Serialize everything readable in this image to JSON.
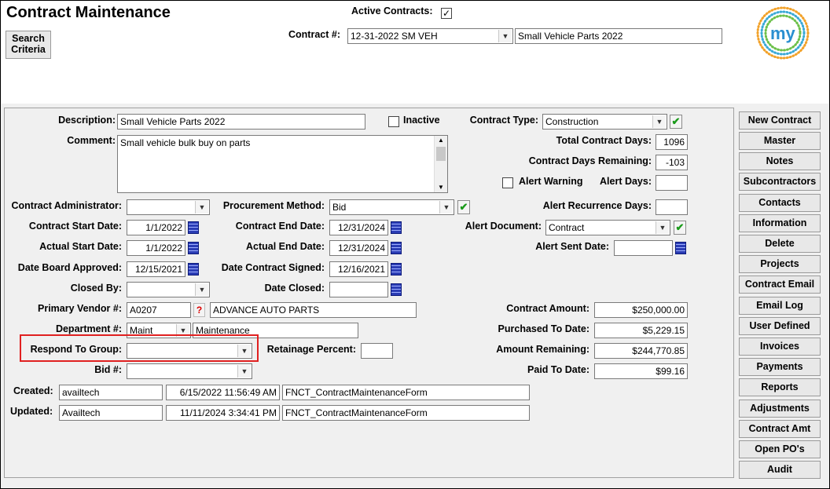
{
  "window": {
    "title": "Contract Maintenance"
  },
  "header": {
    "search_criteria": "Search\nCriteria",
    "active_contracts_label": "Active Contracts:",
    "active_contracts_checked": true,
    "contract_no_label": "Contract #:",
    "contract_no_value": "12-31-2022 SM VEH",
    "contract_name_value": "Small Vehicle Parts 2022",
    "logo_text": "my"
  },
  "form": {
    "description": {
      "label": "Description:",
      "value": "Small Vehicle Parts 2022"
    },
    "inactive": {
      "label": "Inactive",
      "checked": false
    },
    "contract_type": {
      "label": "Contract Type:",
      "value": "Construction"
    },
    "comment": {
      "label": "Comment:",
      "value": "Small vehicle bulk buy on parts"
    },
    "total_contract_days": {
      "label": "Total Contract Days:",
      "value": "1096"
    },
    "contract_days_remaining": {
      "label": "Contract Days Remaining:",
      "value": "-103"
    },
    "alert_warning": {
      "label": "Alert Warning",
      "checked": false
    },
    "alert_days": {
      "label": "Alert Days:",
      "value": ""
    },
    "contract_administrator": {
      "label": "Contract Administrator:",
      "value": ""
    },
    "procurement_method": {
      "label": "Procurement Method:",
      "value": "Bid"
    },
    "alert_recurrence_days": {
      "label": "Alert Recurrence Days:",
      "value": ""
    },
    "contract_start_date": {
      "label": "Contract Start Date:",
      "value": "1/1/2022"
    },
    "contract_end_date": {
      "label": "Contract End Date:",
      "value": "12/31/2024"
    },
    "alert_document": {
      "label": "Alert Document:",
      "value": "Contract"
    },
    "actual_start_date": {
      "label": "Actual Start Date:",
      "value": "1/1/2022"
    },
    "actual_end_date": {
      "label": "Actual End Date:",
      "value": "12/31/2024"
    },
    "alert_sent_date": {
      "label": "Alert Sent Date:",
      "value": ""
    },
    "date_board_approved": {
      "label": "Date Board Approved:",
      "value": "12/15/2021"
    },
    "date_contract_signed": {
      "label": "Date Contract Signed:",
      "value": "12/16/2021"
    },
    "closed_by": {
      "label": "Closed By:",
      "value": ""
    },
    "date_closed": {
      "label": "Date Closed:",
      "value": ""
    },
    "primary_vendor": {
      "label": "Primary Vendor #:",
      "value": "A0207",
      "name": "ADVANCE AUTO PARTS",
      "lookup": "?"
    },
    "contract_amount": {
      "label": "Contract Amount:",
      "value": "$250,000.00"
    },
    "department": {
      "label": "Department #:",
      "value": "Maint",
      "name": "Maintenance"
    },
    "purchased_to_date": {
      "label": "Purchased To Date:",
      "value": "$5,229.15"
    },
    "respond_to_group": {
      "label": "Respond To Group:",
      "value": ""
    },
    "retainage_percent": {
      "label": "Retainage Percent:",
      "value": ""
    },
    "amount_remaining": {
      "label": "Amount Remaining:",
      "value": "$244,770.85"
    },
    "bid_no": {
      "label": "Bid #:",
      "value": ""
    },
    "paid_to_date": {
      "label": "Paid To Date:",
      "value": "$99.16"
    },
    "created": {
      "label": "Created:",
      "user": "availtech",
      "date": "6/15/2022 11:56:49 AM",
      "form": "FNCT_ContractMaintenanceForm"
    },
    "updated": {
      "label": "Updated:",
      "user": "Availtech",
      "date": "11/11/2024 3:34:41 PM",
      "form": "FNCT_ContractMaintenanceForm"
    }
  },
  "sidebar": {
    "buttons": [
      "New Contract",
      "Master",
      "Notes",
      "Subcontractors",
      "Contacts",
      "Information",
      "Delete",
      "Projects",
      "Contract Email",
      "Email Log",
      "User Defined",
      "Invoices",
      "Payments",
      "Reports",
      "Adjustments",
      "Contract Amt",
      "Open PO's",
      "Audit"
    ]
  },
  "colors": {
    "highlight": "#e02020",
    "check_green": "#1a9a1a",
    "calendar_blue": "#2b3db5"
  }
}
